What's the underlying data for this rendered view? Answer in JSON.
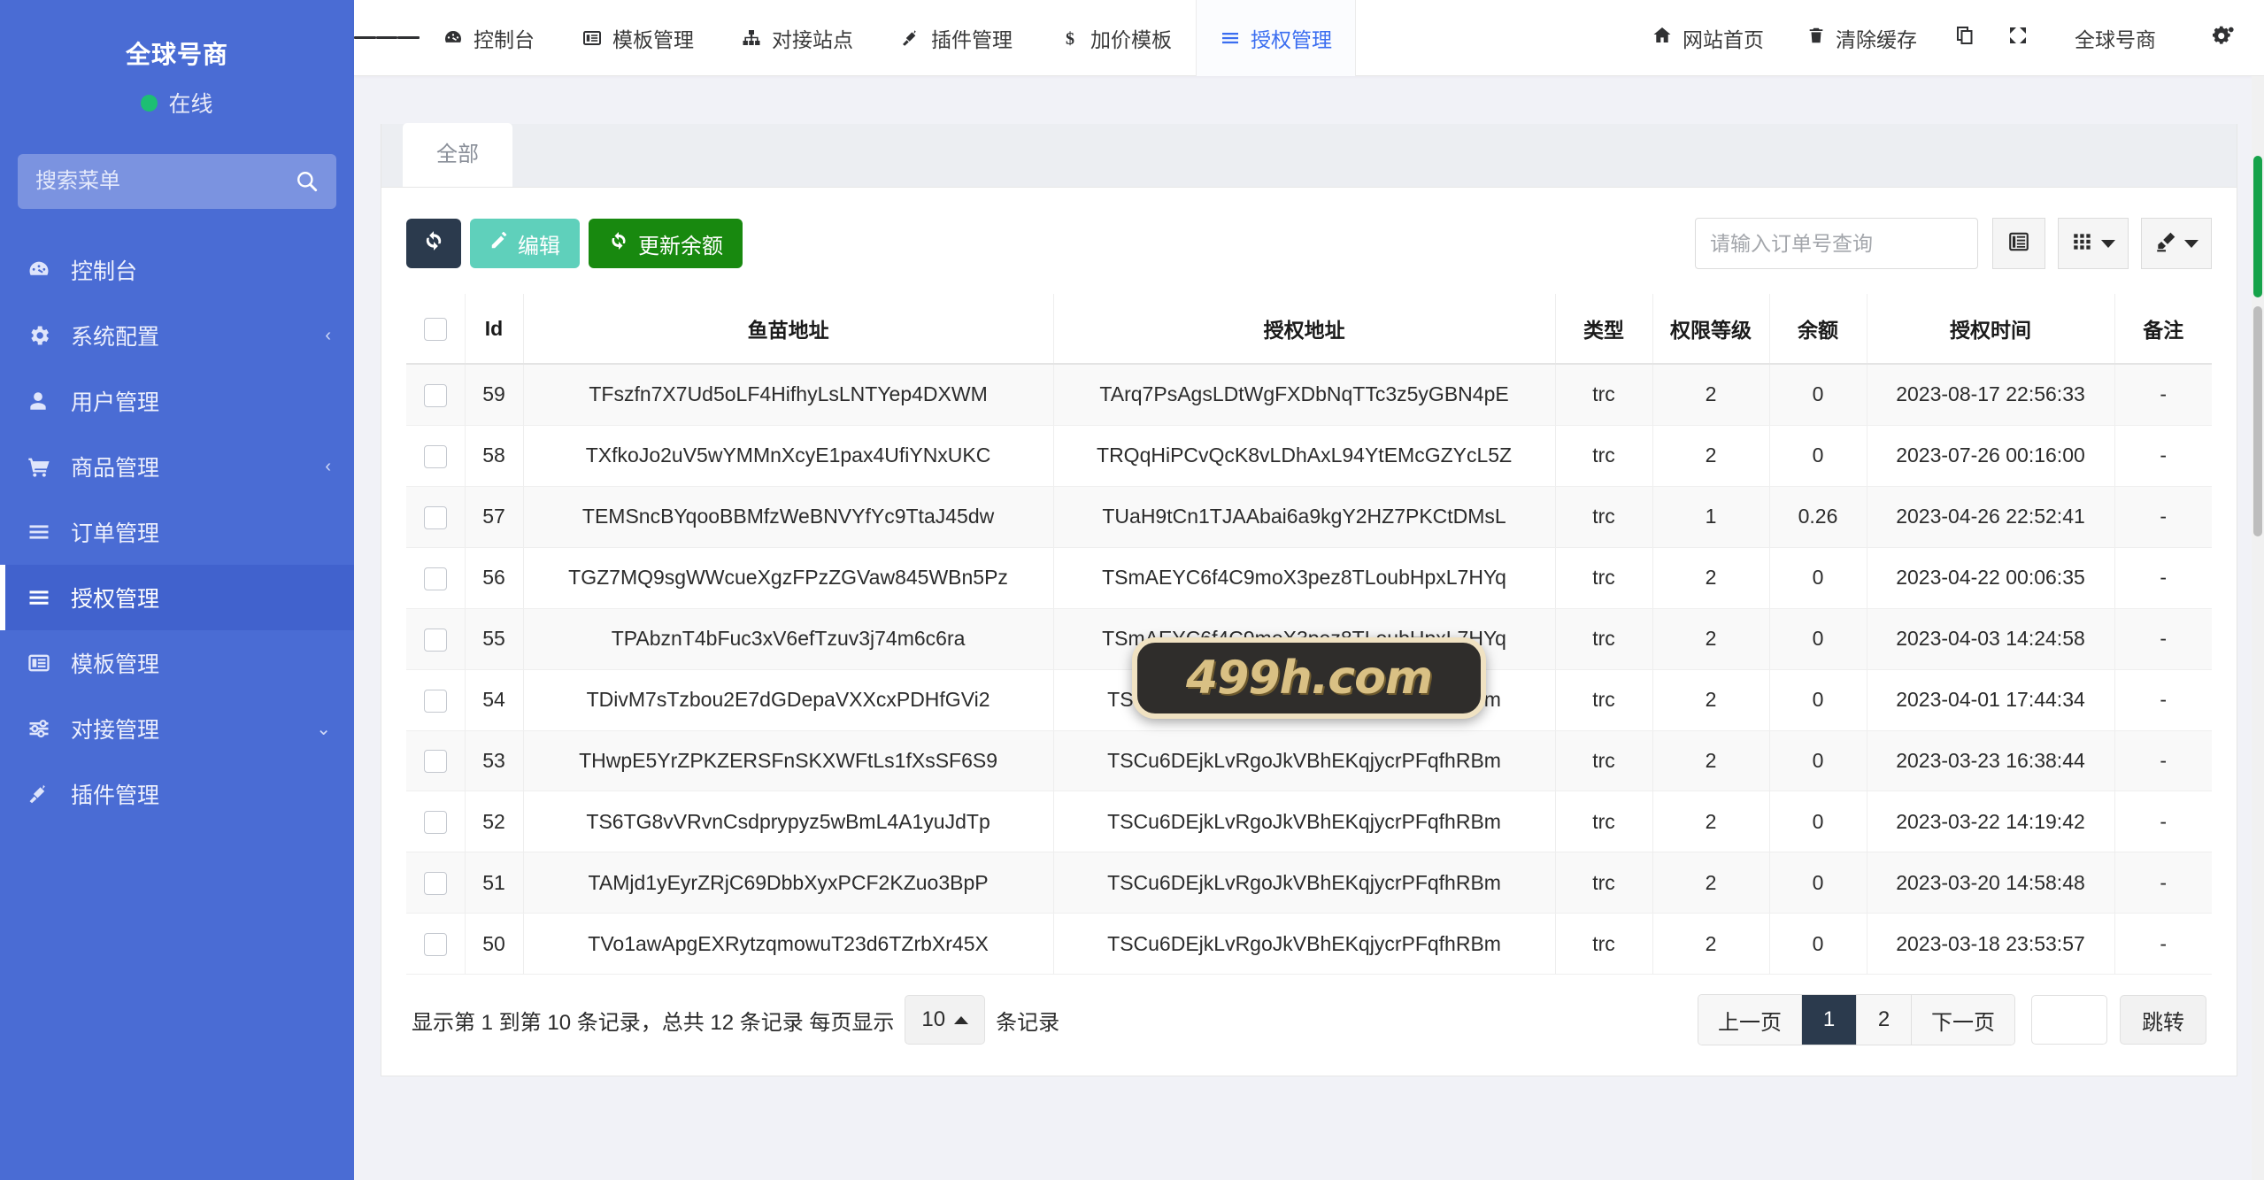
{
  "sidebar": {
    "brand": "全球号商",
    "status": "在线",
    "search_placeholder": "搜索菜单",
    "search_value": "",
    "items": [
      {
        "label": "控制台",
        "icon": "dashboard-icon",
        "arrow": ""
      },
      {
        "label": "系统配置",
        "icon": "gear-icon",
        "arrow": "‹"
      },
      {
        "label": "用户管理",
        "icon": "user-icon",
        "arrow": ""
      },
      {
        "label": "商品管理",
        "icon": "cart-icon",
        "arrow": "‹"
      },
      {
        "label": "订单管理",
        "icon": "list-icon",
        "arrow": ""
      },
      {
        "label": "授权管理",
        "icon": "list-icon",
        "arrow": ""
      },
      {
        "label": "模板管理",
        "icon": "template-icon",
        "arrow": ""
      },
      {
        "label": "对接管理",
        "icon": "sliders-icon",
        "arrow": "⌄"
      },
      {
        "label": "插件管理",
        "icon": "plug-icon",
        "arrow": ""
      }
    ],
    "active_index": 5
  },
  "topbar": {
    "nav": [
      {
        "label": "控制台",
        "icon": "dashboard-icon"
      },
      {
        "label": "模板管理",
        "icon": "template-icon"
      },
      {
        "label": "对接站点",
        "icon": "sitemap-icon"
      },
      {
        "label": "插件管理",
        "icon": "plug-icon"
      },
      {
        "label": "加价模板",
        "icon": "dollar-icon"
      },
      {
        "label": "授权管理",
        "icon": "list-icon"
      }
    ],
    "active_nav_index": 5,
    "right": [
      {
        "label": "网站首页",
        "icon": "home-icon"
      },
      {
        "label": "清除缓存",
        "icon": "trash-icon"
      }
    ],
    "copy_icon": "copy-icon",
    "fullscreen_icon": "fullscreen-icon",
    "user": "全球号商",
    "settings_icon": "gears-icon"
  },
  "panel": {
    "tab": "全部",
    "toolbar": {
      "refresh_icon": "refresh-icon",
      "edit_label": "编辑",
      "edit_icon": "pencil-icon",
      "update_balance_label": "更新余额",
      "update_balance_icon": "refresh-icon",
      "search_placeholder": "请输入订单号查询",
      "search_value": "",
      "columns_icon": "columns-icon",
      "grid_icon": "grid-icon",
      "export_icon": "export-icon"
    },
    "table": {
      "columns": [
        "",
        "Id",
        "鱼苗地址",
        "授权地址",
        "类型",
        "权限等级",
        "余额",
        "授权时间",
        "备注"
      ],
      "rows": [
        {
          "id": "59",
          "addr": "TFszfn7X7Ud5oLF4HifhyLsLNTYep4DXWM",
          "auth": "TArq7PsAgsLDtWgFXDbNqTTc3z5yGBN4pE",
          "type": "trc",
          "level": "2",
          "balance": "0",
          "time": "2023-08-17 22:56:33",
          "note": "-"
        },
        {
          "id": "58",
          "addr": "TXfkoJo2uV5wYMMnXcyE1pax4UfiYNxUKC",
          "auth": "TRQqHiPCvQcK8vLDhAxL94YtEMcGZYcL5Z",
          "type": "trc",
          "level": "2",
          "balance": "0",
          "time": "2023-07-26 00:16:00",
          "note": "-"
        },
        {
          "id": "57",
          "addr": "TEMSncBYqooBBMfzWeBNVYfYc9TtaJ45dw",
          "auth": "TUaH9tCn1TJAAbai6a9kgY2HZ7PKCtDMsL",
          "type": "trc",
          "level": "1",
          "balance": "0.26",
          "time": "2023-04-26 22:52:41",
          "note": "-"
        },
        {
          "id": "56",
          "addr": "TGZ7MQ9sgWWcueXgzFPzZGVaw845WBn5Pz",
          "auth": "TSmAEYC6f4C9moX3pez8TLoubHpxL7HYq",
          "type": "trc",
          "level": "2",
          "balance": "0",
          "time": "2023-04-22 00:06:35",
          "note": "-"
        },
        {
          "id": "55",
          "addr": "TPAbznT4bFuc3xV6efTzuv3j74m6c6ra",
          "auth": "TSmAEYC6f4C9moX3pez8TLoubHpxL7HYq",
          "type": "trc",
          "level": "2",
          "balance": "0",
          "time": "2023-04-03 14:24:58",
          "note": "-"
        },
        {
          "id": "54",
          "addr": "TDivM7sTzbou2E7dGDepaVXXcxPDHfGVi2",
          "auth": "TSCu6DEjkLvRgoJkVBhEKqjycrPFqfhRBm",
          "type": "trc",
          "level": "2",
          "balance": "0",
          "time": "2023-04-01 17:44:34",
          "note": "-"
        },
        {
          "id": "53",
          "addr": "THwpE5YrZPKZERSFnSKXWFtLs1fXsSF6S9",
          "auth": "TSCu6DEjkLvRgoJkVBhEKqjycrPFqfhRBm",
          "type": "trc",
          "level": "2",
          "balance": "0",
          "time": "2023-03-23 16:38:44",
          "note": "-"
        },
        {
          "id": "52",
          "addr": "TS6TG8vVRvnCsdprypyz5wBmL4A1yuJdTp",
          "auth": "TSCu6DEjkLvRgoJkVBhEKqjycrPFqfhRBm",
          "type": "trc",
          "level": "2",
          "balance": "0",
          "time": "2023-03-22 14:19:42",
          "note": "-"
        },
        {
          "id": "51",
          "addr": "TAMjd1yEyrZRjC69DbbXyxPCF2KZuo3BpP",
          "auth": "TSCu6DEjkLvRgoJkVBhEKqjycrPFqfhRBm",
          "type": "trc",
          "level": "2",
          "balance": "0",
          "time": "2023-03-20 14:58:48",
          "note": "-"
        },
        {
          "id": "50",
          "addr": "TVo1awApgEXRytzqmowuT23d6TZrbXr45X",
          "auth": "TSCu6DEjkLvRgoJkVBhEKqjycrPFqfhRBm",
          "type": "trc",
          "level": "2",
          "balance": "0",
          "time": "2023-03-18 23:53:57",
          "note": "-"
        }
      ]
    },
    "pager": {
      "info_prefix": "显示第 1 到第 10 条记录，总共 12 条记录 每页显示",
      "page_size": "10",
      "info_suffix": "条记录",
      "prev": "上一页",
      "pages": [
        "1",
        "2"
      ],
      "current_page": "1",
      "next": "下一页",
      "jump_value": "",
      "jump": "跳转"
    }
  },
  "watermark": {
    "text": "499h.com"
  },
  "colors": {
    "sidebar": "#4a6cd4",
    "sidebar_active": "#4162cd",
    "accent_blue": "#3b6ef0",
    "green": "#18890f",
    "teal": "#5fd0bb",
    "dark": "#2b3a4d",
    "online": "#1dbf73"
  }
}
